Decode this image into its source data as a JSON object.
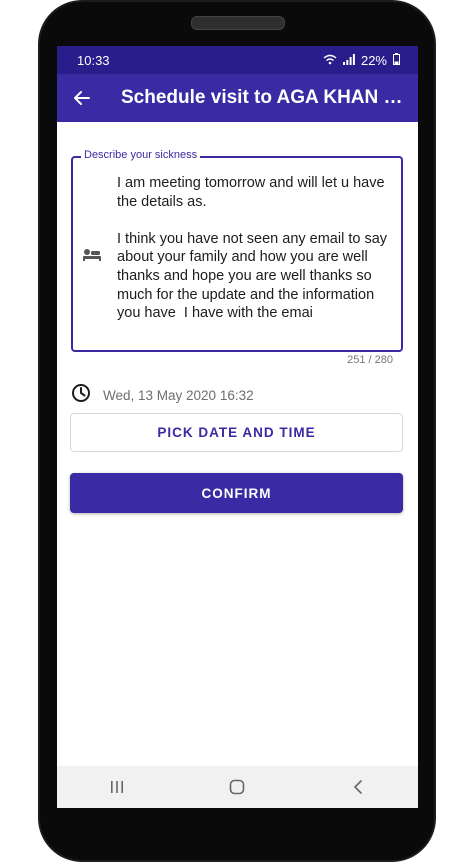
{
  "status": {
    "time": "10:33",
    "battery": "22%"
  },
  "appbar": {
    "title": "Schedule visit to AGA KHAN DI..."
  },
  "form": {
    "label": "Describe your sickness",
    "text": "I am meeting tomorrow and will let u have the details as.\n\nI think you have not seen any email to say about your family and how you are well thanks and hope you are well thanks so much for the update and the information you have  I have with the emai",
    "counter": "251 / 280",
    "date": "Wed, 13 May 2020 16:32"
  },
  "buttons": {
    "pick": "PICK DATE AND TIME",
    "confirm": "CONFIRM"
  },
  "colors": {
    "primary": "#3a2aa3",
    "statusbar": "#281d8a"
  },
  "icons": [
    "back-arrow-icon",
    "wifi-icon",
    "signal-icon",
    "battery-icon",
    "patient-icon",
    "clock-icon",
    "recents-icon",
    "home-icon",
    "back-icon"
  ]
}
